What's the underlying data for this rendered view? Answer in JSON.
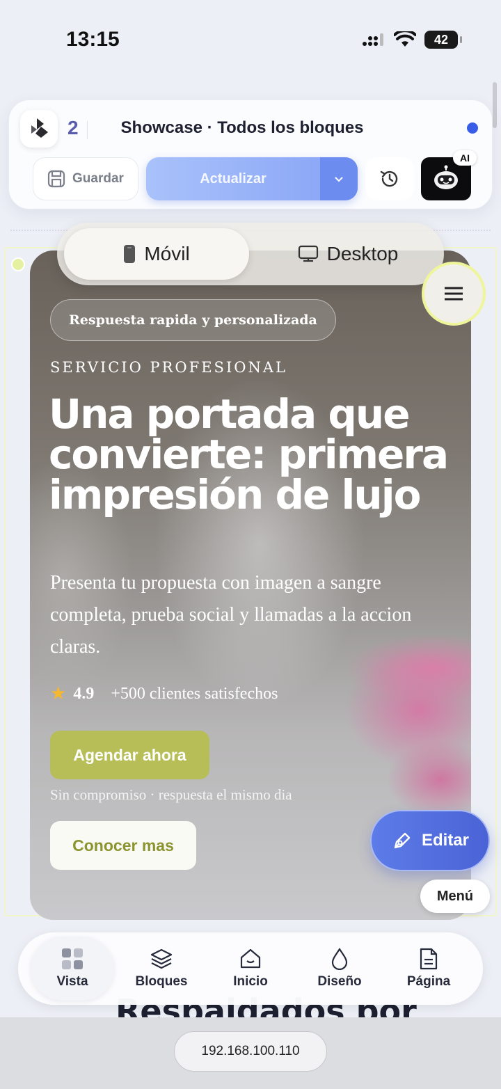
{
  "status_bar": {
    "time": "13:15",
    "battery": "42"
  },
  "toolbar": {
    "block_count": "2",
    "title": "Showcase · Todos los bloques",
    "save_label": "Guardar",
    "update_label": "Actualizar",
    "ai_badge": "AI"
  },
  "view_toggle": {
    "mobile": "Móvil",
    "desktop": "Desktop",
    "selected": "Móvil"
  },
  "hero": {
    "pill": "Respuesta rapida y personalizada",
    "eyebrow": "SERVICIO PROFESIONAL",
    "headline": "Una portada que convierte: primera impresión de lujo",
    "description": "Presenta tu propuesta con imagen a sangre completa, prueba social y llamadas a la accion claras.",
    "rating": "4.9",
    "clients": "+500 clientes satisfechos",
    "cta_primary": "Agendar ahora",
    "note": "Sin compromiso · respuesta el mismo dia",
    "cta_secondary": "Conocer mas"
  },
  "floating": {
    "edit": "Editar",
    "menu": "Menú"
  },
  "below_heading": "Respaldados por",
  "bottom_nav": {
    "items": [
      {
        "label": "Vista",
        "icon": "grid-icon",
        "active": true
      },
      {
        "label": "Bloques",
        "icon": "layers-icon",
        "active": false
      },
      {
        "label": "Inicio",
        "icon": "home-icon",
        "active": false
      },
      {
        "label": "Diseño",
        "icon": "droplet-icon",
        "active": false
      },
      {
        "label": "Página",
        "icon": "page-icon",
        "active": false
      }
    ]
  },
  "browser": {
    "url": "192.168.100.110"
  },
  "colors": {
    "accent": "#4a63d6",
    "cta": "#b7be57",
    "selection": "#eef59a"
  }
}
